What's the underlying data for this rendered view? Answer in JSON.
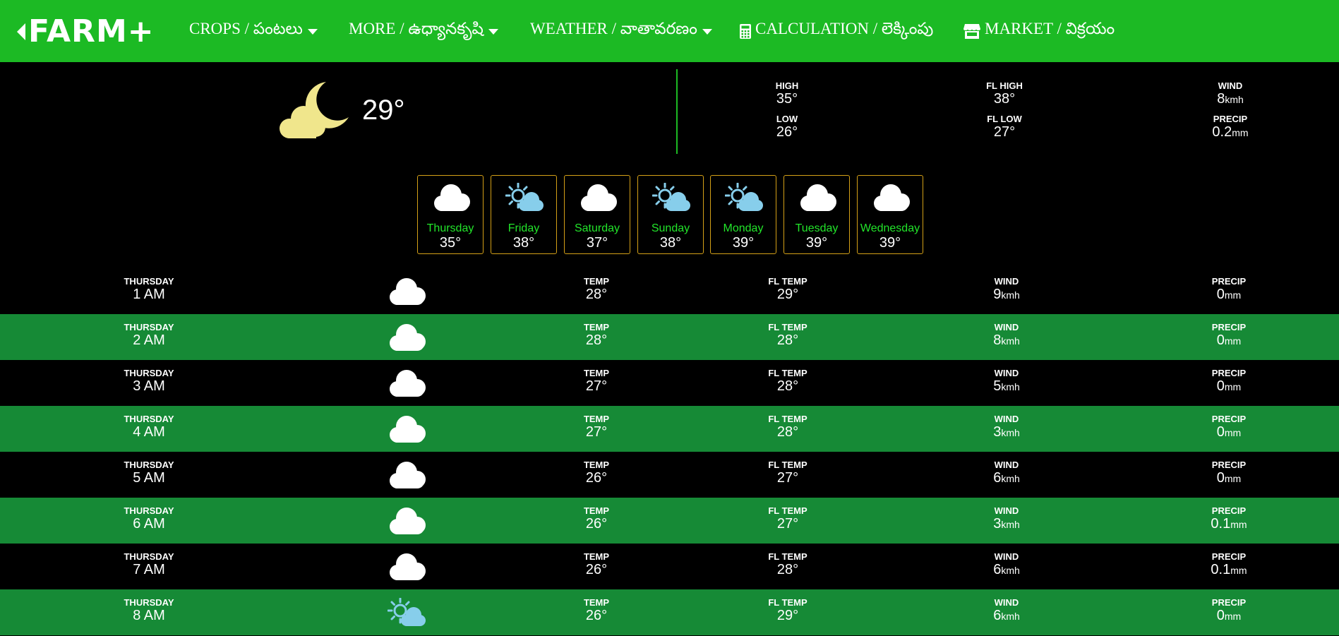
{
  "nav": {
    "logo": "FARM+",
    "items": [
      {
        "label": "CROPS / పంటలు"
      },
      {
        "label": "MORE / ఉధ్యానకృషి"
      },
      {
        "label": "WEATHER / వాతావరణం"
      },
      {
        "label": "CALCULATION / లెక్కింపు"
      },
      {
        "label": "MARKET / విక్రయం"
      }
    ]
  },
  "current": {
    "icon": "cloud-moon-icon",
    "temp": "29°",
    "high_label": "HIGH",
    "high": "35°",
    "low_label": "LOW",
    "low": "26°",
    "fl_high_label": "FL HIGH",
    "fl_high": "38°",
    "fl_low_label": "FL LOW",
    "fl_low": "27°",
    "wind_label": "WIND",
    "wind": "8",
    "wind_unit": "kmh",
    "precip_label": "PRECIP",
    "precip": "0.2",
    "precip_unit": "mm"
  },
  "forecast": [
    {
      "day": "Thursday",
      "temp": "35°",
      "icon": "cloud-icon"
    },
    {
      "day": "Friday",
      "temp": "38°",
      "icon": "sun-cloud-icon"
    },
    {
      "day": "Saturday",
      "temp": "37°",
      "icon": "cloud-icon"
    },
    {
      "day": "Sunday",
      "temp": "38°",
      "icon": "sun-cloud-icon"
    },
    {
      "day": "Monday",
      "temp": "39°",
      "icon": "sun-cloud-icon"
    },
    {
      "day": "Tuesday",
      "temp": "39°",
      "icon": "cloud-icon"
    },
    {
      "day": "Wednesday",
      "temp": "39°",
      "icon": "cloud-icon"
    }
  ],
  "hourly_labels": {
    "temp": "TEMP",
    "fl_temp": "FL TEMP",
    "wind": "WIND",
    "precip": "PRECIP",
    "wind_unit": "kmh",
    "precip_unit": "mm"
  },
  "hourly": [
    {
      "day": "THURSDAY",
      "time": "1 AM",
      "icon": "cloud-icon",
      "temp": "28°",
      "fl_temp": "29°",
      "wind": "9",
      "precip": "0"
    },
    {
      "day": "THURSDAY",
      "time": "2 AM",
      "icon": "cloud-icon",
      "temp": "28°",
      "fl_temp": "28°",
      "wind": "8",
      "precip": "0"
    },
    {
      "day": "THURSDAY",
      "time": "3 AM",
      "icon": "cloud-icon",
      "temp": "27°",
      "fl_temp": "28°",
      "wind": "5",
      "precip": "0"
    },
    {
      "day": "THURSDAY",
      "time": "4 AM",
      "icon": "cloud-icon",
      "temp": "27°",
      "fl_temp": "28°",
      "wind": "3",
      "precip": "0"
    },
    {
      "day": "THURSDAY",
      "time": "5 AM",
      "icon": "cloud-icon",
      "temp": "26°",
      "fl_temp": "27°",
      "wind": "6",
      "precip": "0"
    },
    {
      "day": "THURSDAY",
      "time": "6 AM",
      "icon": "cloud-icon",
      "temp": "26°",
      "fl_temp": "27°",
      "wind": "3",
      "precip": "0.1"
    },
    {
      "day": "THURSDAY",
      "time": "7 AM",
      "icon": "cloud-icon",
      "temp": "26°",
      "fl_temp": "28°",
      "wind": "6",
      "precip": "0.1"
    },
    {
      "day": "THURSDAY",
      "time": "8 AM",
      "icon": "sun-cloud-icon",
      "temp": "26°",
      "fl_temp": "29°",
      "wind": "6",
      "precip": "0"
    }
  ],
  "colors": {
    "nav_bg": "#1cba24",
    "row_alt": "#168a36",
    "day_name": "#22e52a",
    "card_border": "#d4a017",
    "moon_cloud": "#f0e68c",
    "sun_cloud": "#87ceeb"
  }
}
